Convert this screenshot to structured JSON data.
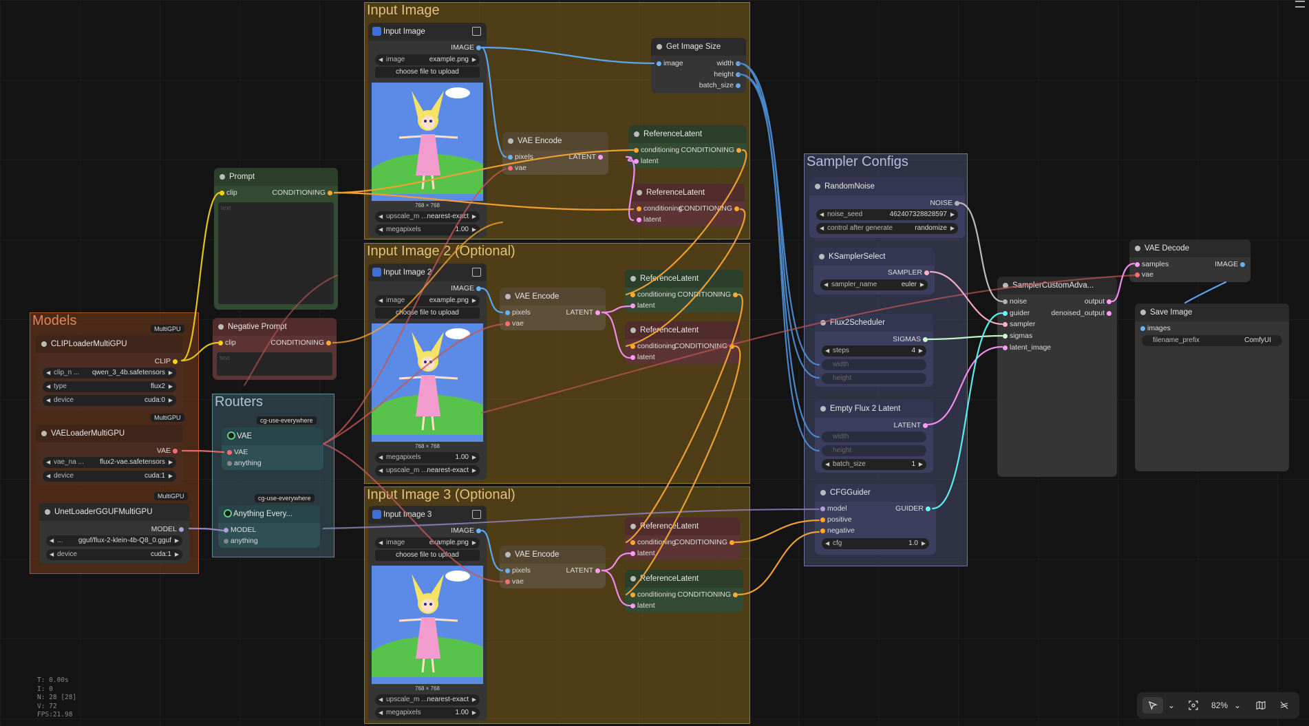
{
  "groups": {
    "input_image": "Input Image",
    "input_image_2": "Input Image 2 (Optional)",
    "input_image_3": "Input Image 3 (Optional)",
    "models": "Models",
    "routers": "Routers",
    "sampler_configs": "Sampler Configs"
  },
  "colors": {
    "image": "#64b5f6",
    "latent": "#ff9cf9",
    "conditioning": "#ffa931",
    "clip": "#ffd500",
    "vae": "#ff6e6e",
    "model": "#b39ddb",
    "noise": "#b0b0b0",
    "sampler": "#ffb3c6",
    "sigmas": "#cdffcd",
    "guider": "#66ffff",
    "int": "#6ca6e8"
  },
  "nodes": {
    "input_image_1": {
      "title": "Input Image",
      "out_image": "IMAGE",
      "image_label": "image",
      "image_value": "example.png",
      "upload": "choose file to upload",
      "resolution": "768 × 768",
      "upscale_label": "upscale_m ...",
      "upscale_value": "nearest-exact",
      "mp_label": "megapixels",
      "mp_value": "1.00"
    },
    "input_image_2": {
      "title": "Input Image 2",
      "out_image": "IMAGE",
      "image_label": "image",
      "image_value": "example.png",
      "upload": "choose file to upload",
      "resolution": "768 × 768",
      "mp_label": "megapixels",
      "mp_value": "1.00",
      "upscale_label": "upscale_m ...",
      "upscale_value": "nearest-exact"
    },
    "input_image_3": {
      "title": "Input Image 3",
      "out_image": "IMAGE",
      "image_label": "image",
      "image_value": "example.png",
      "upload": "choose file to upload",
      "resolution": "768 × 768",
      "upscale_label": "upscale_m ...",
      "upscale_value": "nearest-exact",
      "mp_label": "megapixels",
      "mp_value": "1.00"
    },
    "get_image_size": {
      "title": "Get Image Size",
      "in_image": "image",
      "out_width": "width",
      "out_height": "height",
      "out_batch": "batch_size"
    },
    "vae_encode_1": {
      "title": "VAE Encode",
      "in_pixels": "pixels",
      "in_vae": "vae",
      "out_latent": "LATENT"
    },
    "vae_encode_2": {
      "title": "VAE Encode",
      "in_pixels": "pixels",
      "in_vae": "vae",
      "out_latent": "LATENT"
    },
    "vae_encode_3": {
      "title": "VAE Encode",
      "in_pixels": "pixels",
      "in_vae": "vae",
      "out_latent": "LATENT"
    },
    "ref_latent_1": {
      "title": "ReferenceLatent",
      "in_cond": "conditioning",
      "in_latent": "latent",
      "out_cond": "CONDITIONING"
    },
    "ref_latent_2": {
      "title": "ReferenceLatent",
      "in_cond": "conditioning",
      "in_latent": "latent",
      "out_cond": "CONDITIONING"
    },
    "ref_latent_3": {
      "title": "ReferenceLatent",
      "in_cond": "conditioning",
      "in_latent": "latent",
      "out_cond": "CONDITIONING"
    },
    "ref_latent_4": {
      "title": "ReferenceLatent",
      "in_cond": "conditioning",
      "in_latent": "latent",
      "out_cond": "CONDITIONING"
    },
    "ref_latent_5": {
      "title": "ReferenceLatent",
      "in_cond": "conditioning",
      "in_latent": "latent",
      "out_cond": "CONDITIONING"
    },
    "ref_latent_6": {
      "title": "ReferenceLatent",
      "in_cond": "conditioning",
      "in_latent": "latent",
      "out_cond": "CONDITIONING"
    },
    "prompt": {
      "title": "Prompt",
      "in_clip": "clip",
      "out_cond": "CONDITIONING",
      "placeholder": "text"
    },
    "negative_prompt": {
      "title": "Negative Prompt",
      "in_clip": "clip",
      "out_cond": "CONDITIONING",
      "placeholder": "text"
    },
    "clip_loader": {
      "badge": "MultiGPU",
      "title": "CLIPLoaderMultiGPU",
      "out_clip": "CLIP",
      "w1_label": "clip_n ...",
      "w1_value": "qwen_3_4b.safetensors",
      "w2_label": "type",
      "w2_value": "flux2",
      "w3_label": "device",
      "w3_value": "cuda:0"
    },
    "vae_loader": {
      "badge": "MultiGPU",
      "title": "VAELoaderMultiGPU",
      "out_vae": "VAE",
      "w1_label": "vae_na ...",
      "w1_value": "flux2-vae.safetensors",
      "w2_label": "device",
      "w2_value": "cuda:1"
    },
    "unet_loader": {
      "badge": "MultiGPU",
      "title": "UnetLoaderGGUFMultiGPU",
      "out_model": "MODEL",
      "w1_label": "...",
      "w1_value": "gguf/flux-2-klein-4b-Q8_0.gguf",
      "w2_label": "device",
      "w2_value": "cuda:1"
    },
    "router_vae": {
      "badge": "cg-use-everywhere",
      "title": "VAE",
      "in_vae": "VAE",
      "in_anything": "anything"
    },
    "router_model": {
      "badge": "cg-use-everywhere",
      "title": "Anything Every...",
      "in_model": "MODEL",
      "in_anything": "anything"
    },
    "random_noise": {
      "title": "RandomNoise",
      "out_noise": "NOISE",
      "w1_label": "noise_seed",
      "w1_value": "462407328828597",
      "w2_label": "control after generate",
      "w2_value": "randomize"
    },
    "ksampler_select": {
      "title": "KSamplerSelect",
      "out_sampler": "SAMPLER",
      "w1_label": "sampler_name",
      "w1_value": "euler"
    },
    "flux2_scheduler": {
      "title": "Flux2Scheduler",
      "out_sigmas": "SIGMAS",
      "w1_label": "steps",
      "w1_value": "4",
      "in_width": "width",
      "in_height": "height"
    },
    "empty_latent": {
      "title": "Empty Flux 2 Latent",
      "out_latent": "LATENT",
      "in_width": "width",
      "in_height": "height",
      "w1_label": "batch_size",
      "w1_value": "1"
    },
    "cfg_guider": {
      "title": "CFGGuider",
      "in_model": "model",
      "in_positive": "positive",
      "in_negative": "negative",
      "out_guider": "GUIDER",
      "w1_label": "cfg",
      "w1_value": "1.0"
    },
    "sampler_custom": {
      "title": "SamplerCustomAdva...",
      "in_noise": "noise",
      "in_guider": "guider",
      "in_sampler": "sampler",
      "in_sigmas": "sigmas",
      "in_latent": "latent_image",
      "out_output": "output",
      "out_denoised": "denoised_output"
    },
    "vae_decode": {
      "title": "VAE Decode",
      "in_samples": "samples",
      "in_vae": "vae",
      "out_image": "IMAGE"
    },
    "save_image": {
      "title": "Save Image",
      "in_images": "images",
      "w1_label": "filename_prefix",
      "w1_value": "ComfyUI"
    }
  },
  "stats": {
    "t": "T: 0.00s",
    "i": "I: 0",
    "n": "N: 28 [28]",
    "v": "V: 72",
    "fps": "FPS:21.98"
  },
  "toolbar": {
    "zoom": "82%"
  }
}
